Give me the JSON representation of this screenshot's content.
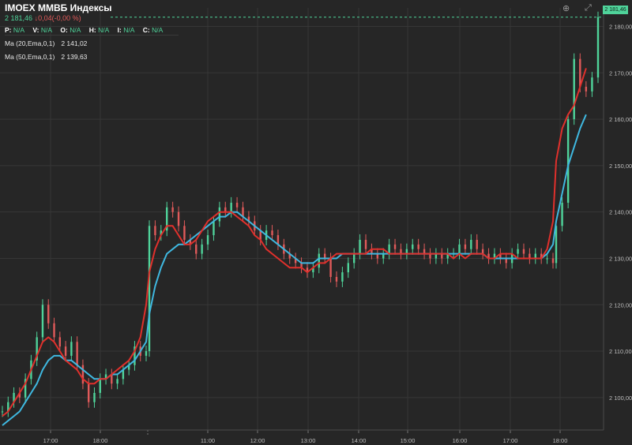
{
  "header": {
    "title": "IMOEX ММВБ Индексы",
    "last_price": "2 181,46",
    "change": "0,04(-0,00 %)",
    "ohlc": [
      {
        "key": "P:",
        "value": "N/A"
      },
      {
        "key": "V:",
        "value": "N/A"
      },
      {
        "key": "O:",
        "value": "N/A"
      },
      {
        "key": "H:",
        "value": "N/A"
      },
      {
        "key": "I:",
        "value": "N/A"
      },
      {
        "key": "C:",
        "value": "N/A"
      }
    ],
    "ma1": {
      "label": "Ma (20,Ema,0,1)",
      "value": "2 141,02"
    },
    "ma2": {
      "label": "Ma (50,Ema,0,1)",
      "value": "2 139,63"
    }
  },
  "price_tag": "2 181,46",
  "colors": {
    "background": "#262626",
    "grid": "#363636",
    "up": "#4fd39a",
    "down": "#e05a5a",
    "ma20": "#e0302c",
    "ma50": "#3fb8e0"
  },
  "icons": [
    "gamepad-icon",
    "expand-icon"
  ],
  "chart_data": {
    "type": "line",
    "title": "IMOEX ММВБ Индексы",
    "xlabel": "",
    "ylabel": "",
    "ylim": [
      2093,
      2184
    ],
    "y_ticks": [
      2100,
      2110,
      2120,
      2130,
      2140,
      2150,
      2160,
      2170,
      2180
    ],
    "y_tick_labels": [
      "2 100,00",
      "2 110,00",
      "2 120,00",
      "2 130,00",
      "2 140,00",
      "2 150,00",
      "2 160,00",
      "2 170,00",
      "2 180,00"
    ],
    "x_tick_labels": [
      "17:00",
      "18:00",
      "11:00",
      "12:00",
      "13:00",
      "14:00",
      "15:00",
      "16:00",
      "17:00",
      "18:00"
    ],
    "grid": true,
    "series": [
      {
        "name": "IMOEX",
        "style": "candlestick-approx",
        "values": [
          2097,
          2099,
          2101,
          2100,
          2104,
          2108,
          2113,
          2120,
          2116,
          2113,
          2111,
          2109,
          2112,
          2107,
          2103,
          2099,
          2101,
          2104,
          2105,
          2103,
          2104,
          2106,
          2107,
          2111,
          2109,
          2110,
          2137,
          2135,
          2136,
          2141,
          2140,
          2137,
          2134,
          2133,
          2131,
          2133,
          2135,
          2138,
          2141,
          2140,
          2142,
          2141,
          2139,
          2138,
          2136,
          2134,
          2136,
          2135,
          2133,
          2131,
          2130,
          2129,
          2128,
          2127,
          2128,
          2131,
          2130,
          2126,
          2125,
          2127,
          2129,
          2131,
          2134,
          2132,
          2131,
          2130,
          2131,
          2133,
          2132,
          2131,
          2132,
          2133,
          2132,
          2131,
          2130,
          2131,
          2130,
          2131,
          2131,
          2133,
          2132,
          2134,
          2132,
          2131,
          2130,
          2131,
          2130,
          2129,
          2131,
          2132,
          2131,
          2130,
          2131,
          2130,
          2130,
          2129,
          2137,
          2142,
          2160,
          2173,
          2167,
          2166,
          2169,
          2182
        ]
      },
      {
        "name": "Ma (20,Ema,0,1)",
        "values": [
          2096,
          2097,
          2099,
          2101,
          2103,
          2106,
          2109,
          2112,
          2113,
          2112,
          2110,
          2108,
          2107,
          2106,
          2104,
          2103,
          2103,
          2104,
          2104,
          2105,
          2106,
          2107,
          2108,
          2110,
          2113,
          2120,
          2127,
          2132,
          2135,
          2137,
          2137,
          2135,
          2133,
          2133,
          2134,
          2136,
          2138,
          2139,
          2140,
          2140,
          2140,
          2139,
          2138,
          2137,
          2135,
          2134,
          2132,
          2131,
          2130,
          2129,
          2128,
          2128,
          2128,
          2127,
          2128,
          2129,
          2129,
          2130,
          2131,
          2131,
          2131,
          2131,
          2131,
          2131,
          2132,
          2132,
          2132,
          2131,
          2131,
          2131,
          2131,
          2131,
          2131,
          2131,
          2131,
          2131,
          2131,
          2131,
          2130,
          2131,
          2130,
          2131,
          2131,
          2131,
          2130,
          2130,
          2131,
          2131,
          2131,
          2130,
          2130,
          2130,
          2130,
          2130,
          2132,
          2138,
          2151,
          2158,
          2161,
          2163,
          2167,
          2171
        ]
      },
      {
        "name": "Ma (50,Ema,0,1)",
        "values": [
          2094,
          2095,
          2096,
          2097,
          2099,
          2101,
          2103,
          2106,
          2108,
          2109,
          2109,
          2108,
          2108,
          2107,
          2106,
          2105,
          2104,
          2104,
          2104,
          2105,
          2105,
          2106,
          2107,
          2108,
          2110,
          2112,
          2118,
          2124,
          2128,
          2131,
          2132,
          2133,
          2133,
          2134,
          2135,
          2136,
          2137,
          2138,
          2139,
          2139,
          2140,
          2140,
          2139,
          2138,
          2137,
          2136,
          2135,
          2134,
          2133,
          2132,
          2131,
          2130,
          2129,
          2129,
          2129,
          2130,
          2130,
          2130,
          2130,
          2131,
          2131,
          2131,
          2131,
          2131,
          2131,
          2131,
          2131,
          2131,
          2131,
          2131,
          2131,
          2131,
          2131,
          2131,
          2131,
          2131,
          2131,
          2131,
          2131,
          2131,
          2131,
          2131,
          2131,
          2131,
          2130,
          2130,
          2130,
          2130,
          2130,
          2130,
          2130,
          2130,
          2130,
          2130,
          2131,
          2133,
          2138,
          2144,
          2150,
          2154,
          2158,
          2161
        ]
      }
    ]
  }
}
